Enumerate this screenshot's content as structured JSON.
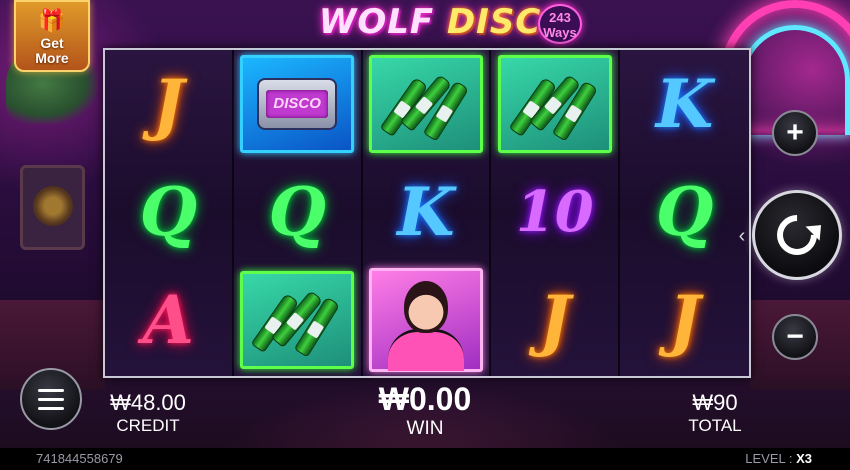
{
  "promo": {
    "get_more_label": "Get\nMore",
    "icon": "gift-icon"
  },
  "logo": {
    "word1": "WOLF",
    "word2": "DISCO",
    "ways_number": "243",
    "ways_label": "Ways"
  },
  "reels": [
    [
      {
        "type": "letter",
        "value": "J"
      },
      {
        "type": "letter",
        "value": "Q"
      },
      {
        "type": "letter",
        "value": "A"
      }
    ],
    [
      {
        "type": "tile",
        "value": "disco-pager",
        "text": "DISCO"
      },
      {
        "type": "letter",
        "value": "Q"
      },
      {
        "type": "tile",
        "value": "bottles"
      }
    ],
    [
      {
        "type": "tile",
        "value": "bottles"
      },
      {
        "type": "letter",
        "value": "K"
      },
      {
        "type": "tile",
        "value": "lady"
      }
    ],
    [
      {
        "type": "tile",
        "value": "bottles"
      },
      {
        "type": "letter",
        "value": "10"
      },
      {
        "type": "letter",
        "value": "J"
      }
    ],
    [
      {
        "type": "letter",
        "value": "K"
      },
      {
        "type": "letter",
        "value": "Q"
      },
      {
        "type": "letter",
        "value": "J"
      }
    ]
  ],
  "controls": {
    "plus_icon": "plus-icon",
    "minus_icon": "minus-icon",
    "spin_icon": "refresh-icon",
    "menu_icon": "hamburger-menu-icon",
    "chevron_icon": "chevron-left-icon"
  },
  "stats": {
    "credit_value": "₩48.00",
    "credit_label": "CREDIT",
    "win_value": "₩0.00",
    "win_label": "WIN",
    "total_value": "₩90",
    "total_label": "TOTAL"
  },
  "footer": {
    "game_id": "741844558679",
    "level_label": "LEVEL :",
    "level_value": "X3"
  },
  "colors": {
    "symbol_J": "#ffb43a",
    "symbol_Q": "#4aff6a",
    "symbol_K": "#55c8ff",
    "symbol_A": "#ff4f8a",
    "symbol_10": "#d86aff"
  }
}
